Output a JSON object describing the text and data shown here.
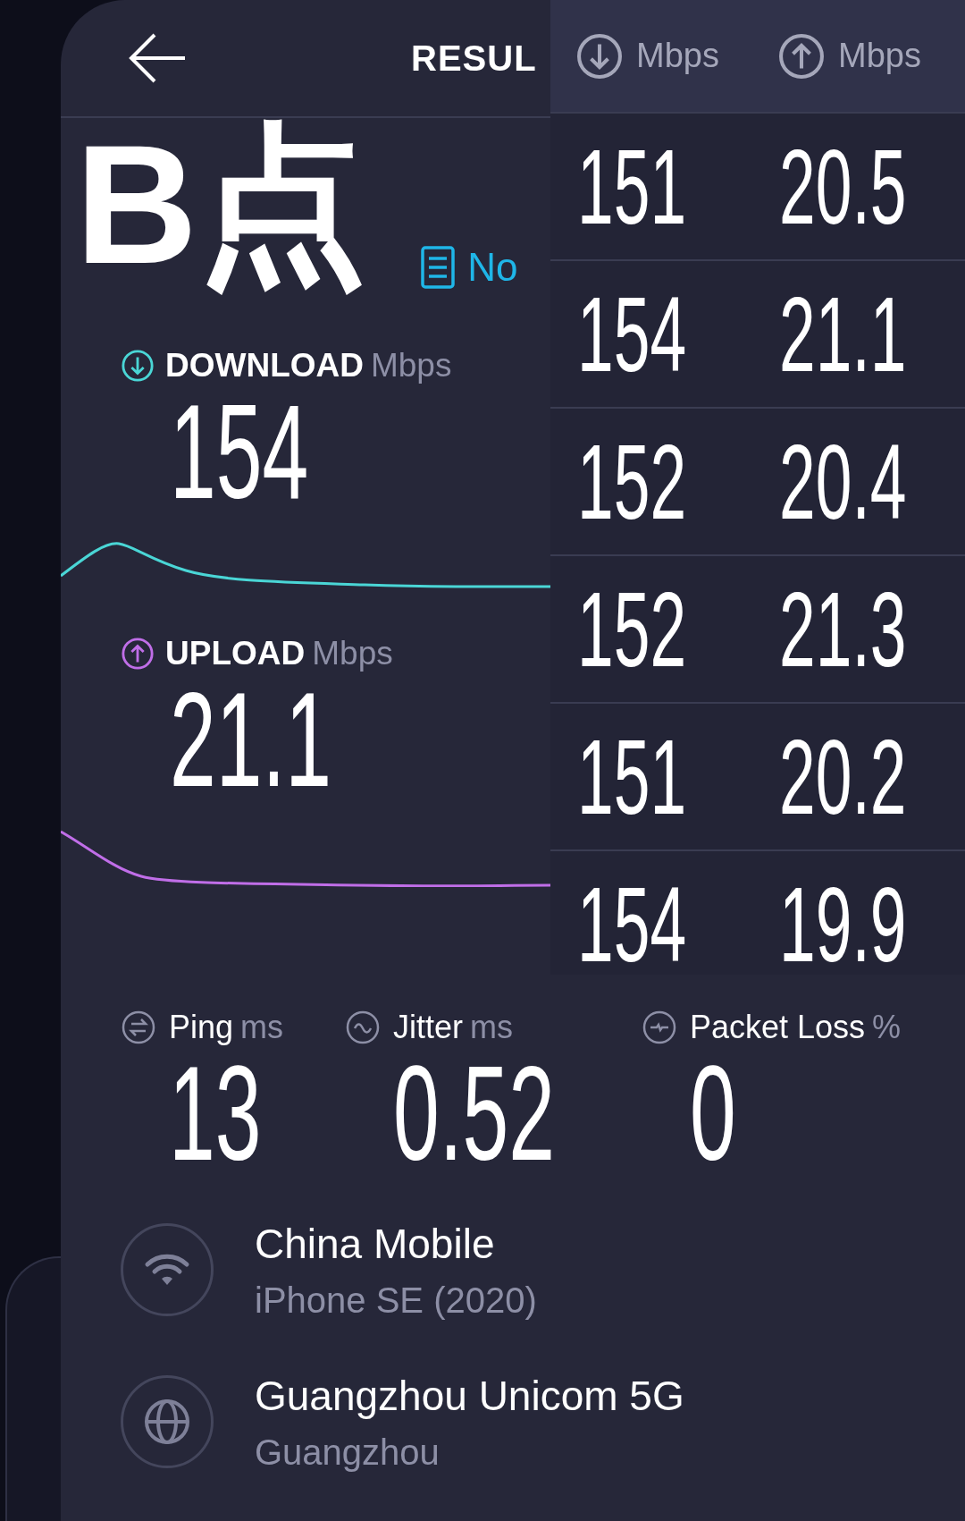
{
  "header": {
    "title": "RESUL"
  },
  "overlay_title": "B点",
  "note_link": "No",
  "download": {
    "label": "DOWNLOAD",
    "unit": "Mbps",
    "value": "154"
  },
  "upload": {
    "label": "UPLOAD",
    "unit": "Mbps",
    "value": "21.1"
  },
  "history": {
    "columns": [
      {
        "kind": "download",
        "unit": "Mbps"
      },
      {
        "kind": "upload",
        "unit": "Mbps"
      }
    ],
    "rows": [
      [
        "151",
        "20.5"
      ],
      [
        "154",
        "21.1"
      ],
      [
        "152",
        "20.4"
      ],
      [
        "152",
        "21.3"
      ],
      [
        "151",
        "20.2"
      ],
      [
        "154",
        "19.9"
      ]
    ]
  },
  "metrics": [
    {
      "kind": "ping",
      "label": "Ping",
      "unit": "ms",
      "value": "13"
    },
    {
      "kind": "jitter",
      "label": "Jitter",
      "unit": "ms",
      "value": "0.52"
    },
    {
      "kind": "packet_loss",
      "label": "Packet Loss",
      "unit": "%",
      "value": "0"
    }
  ],
  "connection": [
    {
      "kind": "wifi",
      "name": "China Mobile",
      "detail": "iPhone SE (2020)"
    },
    {
      "kind": "server",
      "name": "Guangzhou Unicom 5G",
      "detail": "Guangzhou"
    }
  ]
}
